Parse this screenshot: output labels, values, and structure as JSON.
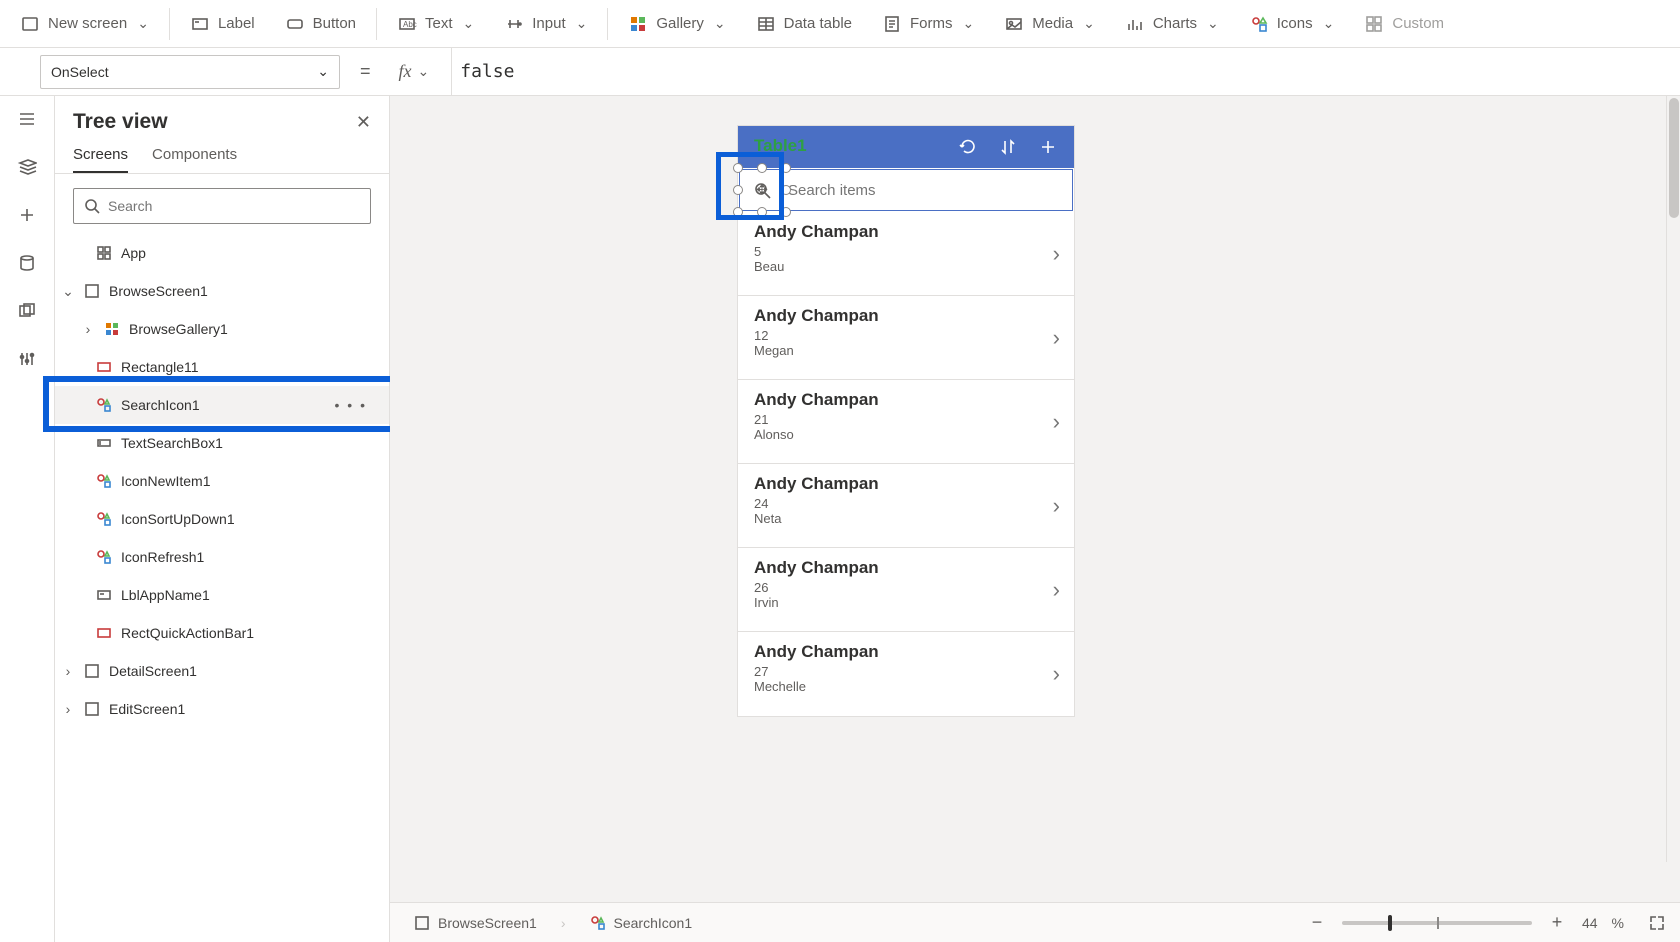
{
  "ribbon": {
    "newScreen": "New screen",
    "label": "Label",
    "button": "Button",
    "text": "Text",
    "input": "Input",
    "gallery": "Gallery",
    "dataTable": "Data table",
    "forms": "Forms",
    "media": "Media",
    "charts": "Charts",
    "icons": "Icons",
    "custom": "Custom"
  },
  "formulaBar": {
    "property": "OnSelect",
    "value": "false"
  },
  "treePanel": {
    "title": "Tree view",
    "tabs": {
      "screens": "Screens",
      "components": "Components"
    },
    "searchPlaceholder": "Search",
    "nodes": {
      "app": "App",
      "browseScreen": "BrowseScreen1",
      "browseGallery": "BrowseGallery1",
      "rectangle11": "Rectangle11",
      "searchIcon1": "SearchIcon1",
      "textSearchBox1": "TextSearchBox1",
      "iconNewItem1": "IconNewItem1",
      "iconSortUpDown1": "IconSortUpDown1",
      "iconRefresh1": "IconRefresh1",
      "lblAppName1": "LblAppName1",
      "rectQuickActionBar1": "RectQuickActionBar1",
      "detailScreen1": "DetailScreen1",
      "editScreen1": "EditScreen1"
    }
  },
  "phone": {
    "appTitle": "Table1",
    "searchPlaceholder": "Search items"
  },
  "galleryItems": [
    {
      "title": "Andy Champan",
      "sub": "5",
      "caption": "Beau"
    },
    {
      "title": "Andy Champan",
      "sub": "12",
      "caption": "Megan"
    },
    {
      "title": "Andy Champan",
      "sub": "21",
      "caption": "Alonso"
    },
    {
      "title": "Andy Champan",
      "sub": "24",
      "caption": "Neta"
    },
    {
      "title": "Andy Champan",
      "sub": "26",
      "caption": "Irvin"
    },
    {
      "title": "Andy Champan",
      "sub": "27",
      "caption": "Mechelle"
    }
  ],
  "breadcrumb": {
    "screen": "BrowseScreen1",
    "element": "SearchIcon1"
  },
  "zoom": {
    "valueLabel": "44",
    "unit": "%"
  }
}
